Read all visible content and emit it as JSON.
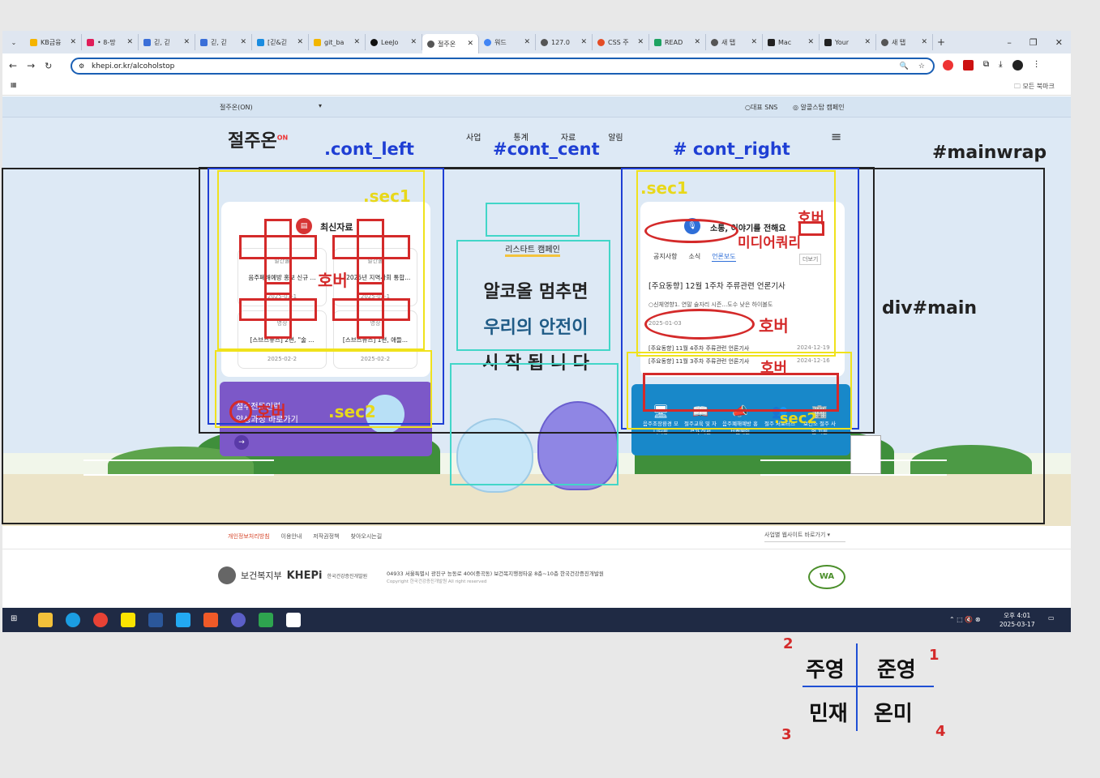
{
  "browser": {
    "tabs": [
      "KB금융",
      "• 8-망",
      "긷, 긷",
      "긷, 긷",
      "[긷&긷",
      "git_ba",
      "LeeJo",
      "절주온",
      "워드",
      "127.0",
      "CSS 주",
      "READ",
      "새 탭",
      "Mac",
      "Your",
      "새 탭"
    ],
    "url": "khepi.or.kr/alcoholstop",
    "bookmarks_label": "모든 북마크"
  },
  "site": {
    "top_left": "절주온(ON)",
    "top_right_1": "대표 SNS",
    "top_right_2": "알콜스탑 캠페인",
    "logo": "절주온",
    "logo_sup": "ON",
    "nav": [
      "사업",
      "통계",
      "자료",
      "알림"
    ],
    "left": {
      "title": "최신자료",
      "items": [
        {
          "tag": "발간물",
          "title": "음주폐해예방 홍보 신규 ...",
          "date": "2025-03-1"
        },
        {
          "tag": "발간물",
          "title": "「2025년 지역사회 통합...",
          "date": "2025-03-1"
        },
        {
          "tag": "영상",
          "title": "[스브스뉴스] 2편, \"술 ...",
          "date": "2025-02-2"
        },
        {
          "tag": "영상",
          "title": "[스브스뉴스] 1편, 애들...",
          "date": "2025-02-2"
        }
      ],
      "promo_line1": "절주전문인력",
      "promo_line2": "양성과정 바로가기",
      "promo_arrow": "→"
    },
    "center": {
      "badge": "리스타트 캠페인",
      "line1": "알코올 멈추면",
      "line2": "우리의 안전이",
      "line3": "시 작 됩 니 다"
    },
    "right": {
      "title": "소통, 이야기를 전해요",
      "tabs": [
        "공지사항",
        "소식",
        "언론보도"
      ],
      "more": "더보기",
      "headline": "[주요동향] 12월 1주차 주류관련 언론기사",
      "sub": "○신체영향1. 연말 술자리 시즌…도수 낮은 하이볼도",
      "date": "2025-01-03",
      "list": [
        {
          "title": "[주요동향] 11월 4주차 주류관련 언론기사",
          "date": "2024-12-19"
        },
        {
          "title": "[주요동향] 11월 3주차 주류관련 언론기사",
          "date": "2024-12-16"
        }
      ],
      "icons": [
        {
          "name": "monitor-icon",
          "label": "음주조장환경 모니터링"
        },
        {
          "name": "book-icon",
          "label": "절주교육 및 자료가 이선"
        },
        {
          "name": "megaphone-icon",
          "label": "음주폐해예방 홍보캠페인"
        },
        {
          "name": "people-icon",
          "label": "절주 서포터즈"
        },
        {
          "name": "building-icon",
          "label": "보건소 절주 사업 지원"
        }
      ]
    },
    "footer": {
      "links": [
        "개인정보처리방침",
        "이용안내",
        "저작권정책",
        "찾아오시는길"
      ],
      "site_select": "사업별 웹사이트 바로가기",
      "ministry": "보건복지부",
      "khepi": "KHEPi",
      "khepi_sub": "한국건강증진개발원",
      "address": "04933 서울특별시 광진구 능동로 400(중곡동) 보건복지행정타운 8층~10층 한국건강증진개발원",
      "copyright": "Copyright 한국건강증진개발원 All right reserved",
      "wa_mark": "WA"
    }
  },
  "annotations": {
    "cont_left": ".cont_left",
    "cont_cent": "#cont_cent",
    "cont_right": "# cont_right",
    "mainwrap": "#mainwrap",
    "main": "div#main",
    "sec1_left": ".sec1",
    "sec2_left": ".sec2",
    "sec1_right": ".sec1",
    "sec2_right": ".sec2",
    "hover": "호버",
    "media_query": "미디어쿼리"
  },
  "taskbar": {
    "time": "오후 4:01",
    "date": "2025-03-17"
  },
  "legend": {
    "cells": [
      {
        "num": "2",
        "name": "주영"
      },
      {
        "num": "1",
        "name": "준영"
      },
      {
        "num": "3",
        "name": "민재"
      },
      {
        "num": "4",
        "name": "온미"
      }
    ]
  },
  "colors": {
    "annotation_red": "#d42a2a",
    "annotation_yellow": "#f0e21c",
    "annotation_blue": "#1f3fd4",
    "annotation_teal": "#42d6c8",
    "promo_purple": "#7c58c8",
    "icon_panel": "#1888c9"
  }
}
